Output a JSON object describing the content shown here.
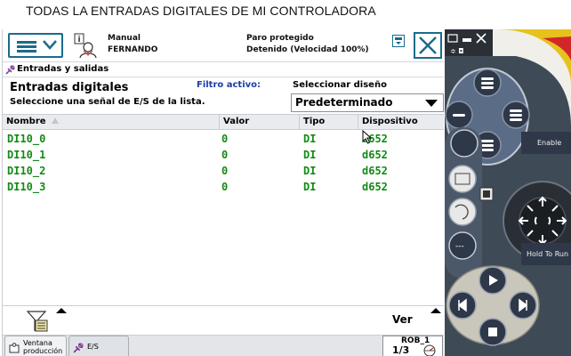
{
  "caption": "TODAS LA ENTRADAS DIGITALES DE MI CONTROLADORA",
  "status": {
    "mode": "Manual",
    "user": "FERNANDO",
    "state": "Paro protegido",
    "speed": "Detenido (Velocidad 100%)"
  },
  "breadcrumb": "Entradas y salidas",
  "header": {
    "title": "Entradas digitales",
    "subtitle": "Seleccione una señal de E/S de la lista.",
    "filter_label": "Filtro activo:",
    "design_label": "Seleccionar diseño",
    "design_value": "Predeterminado"
  },
  "table": {
    "columns": [
      "Nombre",
      "Valor",
      "Tipo",
      "Dispositivo"
    ],
    "rows": [
      [
        "DI10_0",
        "0",
        "DI",
        "d652"
      ],
      [
        "DI10_1",
        "0",
        "DI",
        "d652"
      ],
      [
        "DI10_2",
        "0",
        "DI",
        "d652"
      ],
      [
        "DI10_3",
        "0",
        "DI",
        "d652"
      ]
    ]
  },
  "bottombar": {
    "view_label": "Ver"
  },
  "taskbar": {
    "tasks": [
      {
        "label": "Ventana producción",
        "icon": "production-window-icon",
        "active": true
      },
      {
        "label": "E/S",
        "icon": "io-icon",
        "active": false
      }
    ],
    "robot": {
      "name": "ROB_1",
      "fraction": "1/3"
    }
  },
  "hardware": {
    "enable_label": "Enable",
    "hold_label": "Hold To Run"
  },
  "colors": {
    "accent": "#1a6b8c",
    "signal_text": "#138a17",
    "filter_text": "#1a3ea8"
  }
}
